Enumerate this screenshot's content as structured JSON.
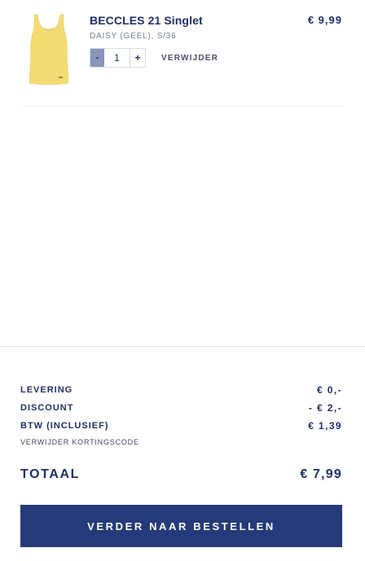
{
  "item": {
    "name": "BECCLES 21 Singlet",
    "variant": "DAISY (GEEL), S/36",
    "price": "€ 9,99",
    "quantity": "1",
    "minus_label": "-",
    "plus_label": "+",
    "remove_label": "VERWIJDER",
    "image_icon": "yellow-singlet-product-image",
    "image_color": "#f5e07a"
  },
  "summary": {
    "shipping_label": "LEVERING",
    "shipping_value": "€ 0,-",
    "discount_label": "DISCOUNT",
    "discount_value": "- € 2,-",
    "vat_label": "BTW (INCLUSIEF)",
    "vat_value": "€ 1,39",
    "remove_coupon_label": "VERWIJDER KORTINGSCODE"
  },
  "total": {
    "label": "TOTAAL",
    "value": "€ 7,99"
  },
  "checkout": {
    "label": "VERDER NAAR BESTELLEN",
    "color": "#253a7a"
  }
}
